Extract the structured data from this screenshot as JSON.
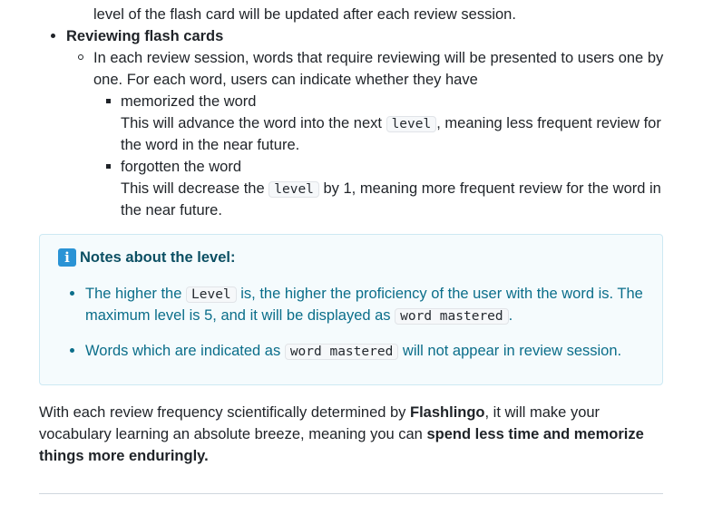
{
  "intro_tail": {
    "text": "level of the flash card will be updated after each review session."
  },
  "reviewing": {
    "heading": "Reviewing flash cards",
    "desc_line1": "In each review session, words that require reviewing will be presented to users one by",
    "desc_line2": "one. For each word, users can indicate whether they have",
    "memorized": {
      "label": "memorized the word",
      "pre": "This will advance the word into the next ",
      "code": "level",
      "post": ", meaning less frequent review for",
      "line2": "the word in the near future."
    },
    "forgotten": {
      "label": "forgotten the word",
      "pre": "This will decrease the ",
      "code": "level",
      "post": " by 1, meaning more frequent review for the word in",
      "line2": "the near future."
    }
  },
  "note": {
    "icon": "info-icon",
    "title": "Notes about the level:",
    "item1": {
      "pre": "The higher the ",
      "code1": "Level",
      "mid": " is, the higher the proficiency of the user with the word is. The",
      "line2_pre": "maximum level is 5, and it will be displayed as ",
      "code2": "word mastered",
      "line2_post": "."
    },
    "item2": {
      "pre": "Words which are indicated as ",
      "code": "word mastered",
      "post": " will not appear in review session."
    }
  },
  "outro": {
    "line1_pre": "With each review frequency scientifically determined by ",
    "brand": "Flashlingo",
    "line1_post": ", it will make your",
    "line2_pre": "vocabulary learning an absolute breeze, meaning you can ",
    "line2_bold": "spend less time and memorize",
    "line3_bold": "things more enduringly."
  },
  "colors": {
    "note_border": "#cde9f3",
    "note_bg": "#f5fbfd",
    "note_text": "#0b6e8a",
    "info_icon": "#2a93d5"
  }
}
